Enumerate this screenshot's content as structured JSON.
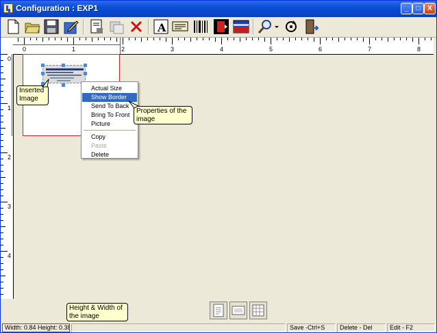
{
  "window": {
    "title": "Configuration : EXP1",
    "min_label": "_",
    "max_label": "□",
    "close_label": "X"
  },
  "toolbar": {
    "items": [
      {
        "icon": "new-document-icon"
      },
      {
        "icon": "open-folder-icon"
      },
      {
        "icon": "save-disk-icon"
      },
      {
        "icon": "edit-page-icon"
      },
      {
        "icon": "page-setup-icon"
      },
      {
        "icon": "copy-layout-icon"
      },
      {
        "icon": "delete-x-icon"
      },
      {
        "icon": "text-tool-icon",
        "glyph": "A"
      },
      {
        "icon": "text-frame-icon"
      },
      {
        "icon": "barcode-icon"
      },
      {
        "icon": "record-icon"
      },
      {
        "icon": "image-icon"
      },
      {
        "icon": "zoom-icon"
      },
      {
        "icon": "rotate-icon"
      },
      {
        "icon": "exit-icon"
      }
    ]
  },
  "ruler": {
    "h_labels": [
      "0",
      "1",
      "2",
      "3",
      "4",
      "5",
      "6",
      "7",
      "8"
    ],
    "v_labels": [
      "0",
      "1",
      "2",
      "3",
      "4"
    ]
  },
  "callouts": {
    "inserted_image": "Inserted Image",
    "properties": "Properties of the image",
    "size": "Height & Width of the image"
  },
  "context_menu": {
    "items": [
      {
        "label": "Actual Size",
        "state": "normal"
      },
      {
        "label": "Show Border",
        "state": "selected"
      },
      {
        "label": "Send To Back",
        "state": "normal"
      },
      {
        "label": "Bring To Front",
        "state": "normal"
      },
      {
        "label": "Picture",
        "state": "normal"
      },
      {
        "label": "Copy",
        "state": "normal"
      },
      {
        "label": "Paste",
        "state": "disabled"
      },
      {
        "label": "Delete",
        "state": "normal"
      }
    ]
  },
  "bottom_buttons": [
    {
      "icon": "page-view-icon"
    },
    {
      "icon": "label-view-icon"
    },
    {
      "icon": "grid-view-icon"
    }
  ],
  "status": {
    "dimensions": "Width: 0.84 Height: 0.38",
    "save": "Save -Ctrl+S",
    "delete": "Delete - Del",
    "edit": "Edit - F2"
  },
  "colors": {
    "titlebar": "#0a4fd6",
    "menu_selection": "#316ac5",
    "label_border": "#e02020",
    "callout_bg": "#fffecc"
  }
}
